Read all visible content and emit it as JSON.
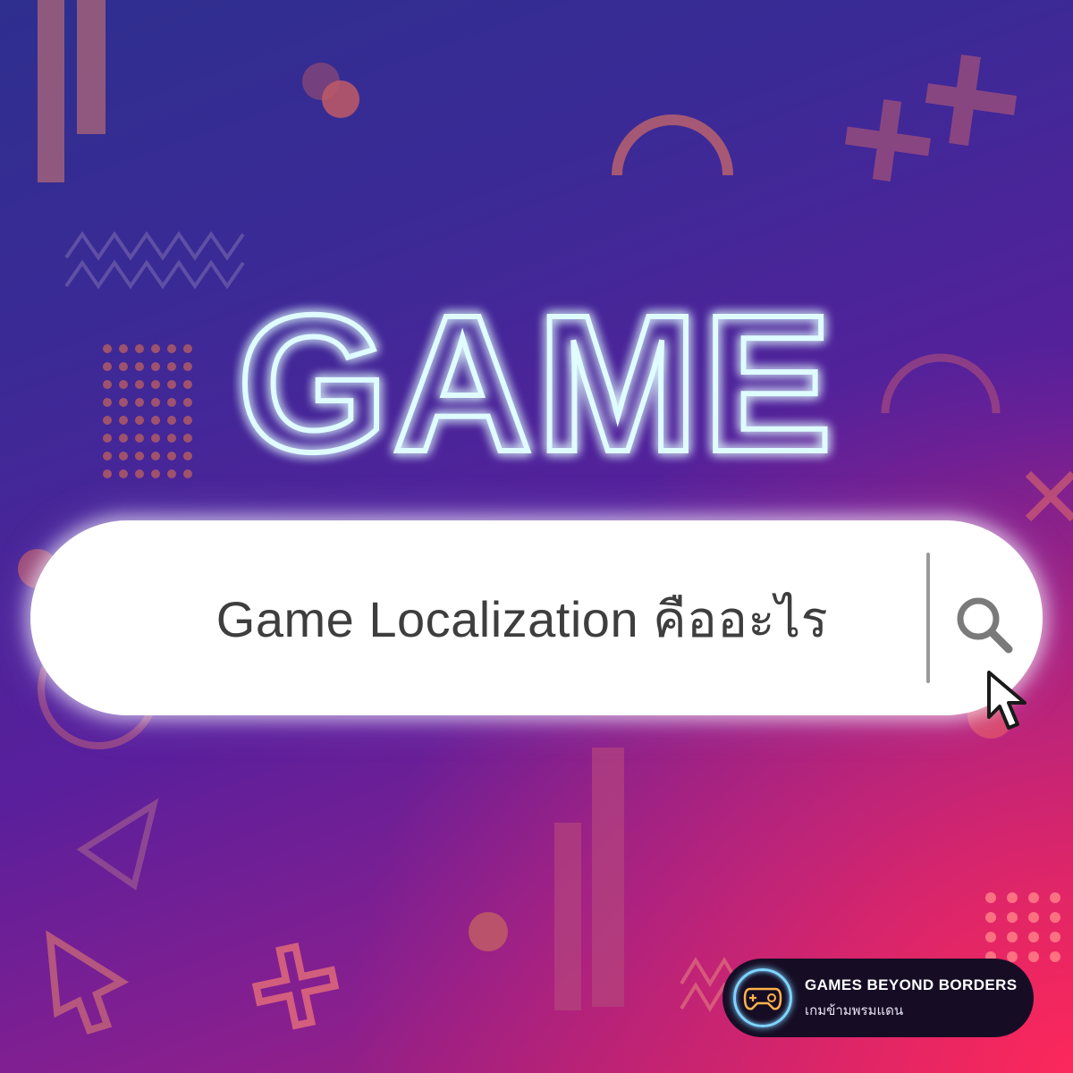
{
  "headline": {
    "text": "GAME",
    "glow_color": "#7ff3ff"
  },
  "search": {
    "query": "Game Localization คืออะไร",
    "icon": "search-icon"
  },
  "cursor": {
    "icon": "pointer-cursor-icon"
  },
  "brand": {
    "title": "GAMES BEYOND BORDERS",
    "subtitle": "เกมข้ามพรมแดน",
    "logo_icon": "gamepad-icon"
  },
  "colors": {
    "background_top": "#2e2f8f",
    "background_bottom": "#e0285f",
    "neon": "#7ff3ff",
    "decor": "#c05a66"
  }
}
